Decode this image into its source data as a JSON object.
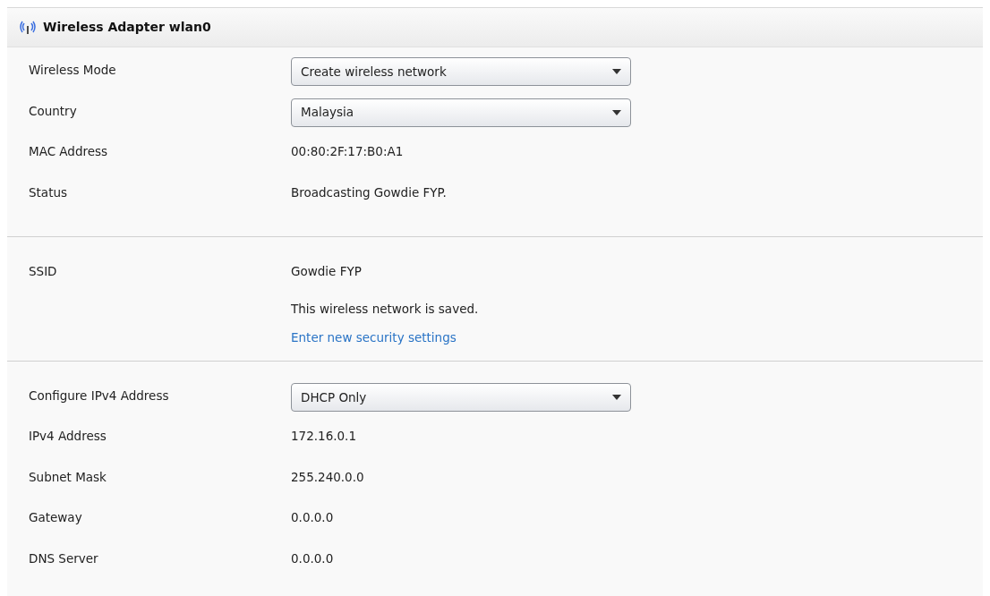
{
  "panel": {
    "title": "Wireless Adapter wlan0"
  },
  "sections": [
    {
      "rows": [
        {
          "kind": "select",
          "label": "Wireless Mode",
          "value": "Create wireless network"
        },
        {
          "kind": "select",
          "label": "Country",
          "value": "Malaysia"
        },
        {
          "kind": "text",
          "label": "MAC Address",
          "value": "00:80:2F:17:B0:A1"
        },
        {
          "kind": "text",
          "label": "Status",
          "value": "Broadcasting Gowdie FYP."
        }
      ]
    },
    {
      "rows": [
        {
          "kind": "note",
          "label": "SSID",
          "value": "Gowdie FYP",
          "note": "This wireless network is saved.",
          "link": "Enter new security settings"
        }
      ]
    },
    {
      "rows": [
        {
          "kind": "select",
          "label": "Configure IPv4 Address",
          "value": "DHCP Only"
        },
        {
          "kind": "text",
          "label": "IPv4 Address",
          "value": "172.16.0.1"
        },
        {
          "kind": "text",
          "label": "Subnet Mask",
          "value": "255.240.0.0"
        },
        {
          "kind": "text",
          "label": "Gateway",
          "value": "0.0.0.0"
        },
        {
          "kind": "text",
          "label": "DNS Server",
          "value": "0.0.0.0"
        }
      ]
    }
  ]
}
